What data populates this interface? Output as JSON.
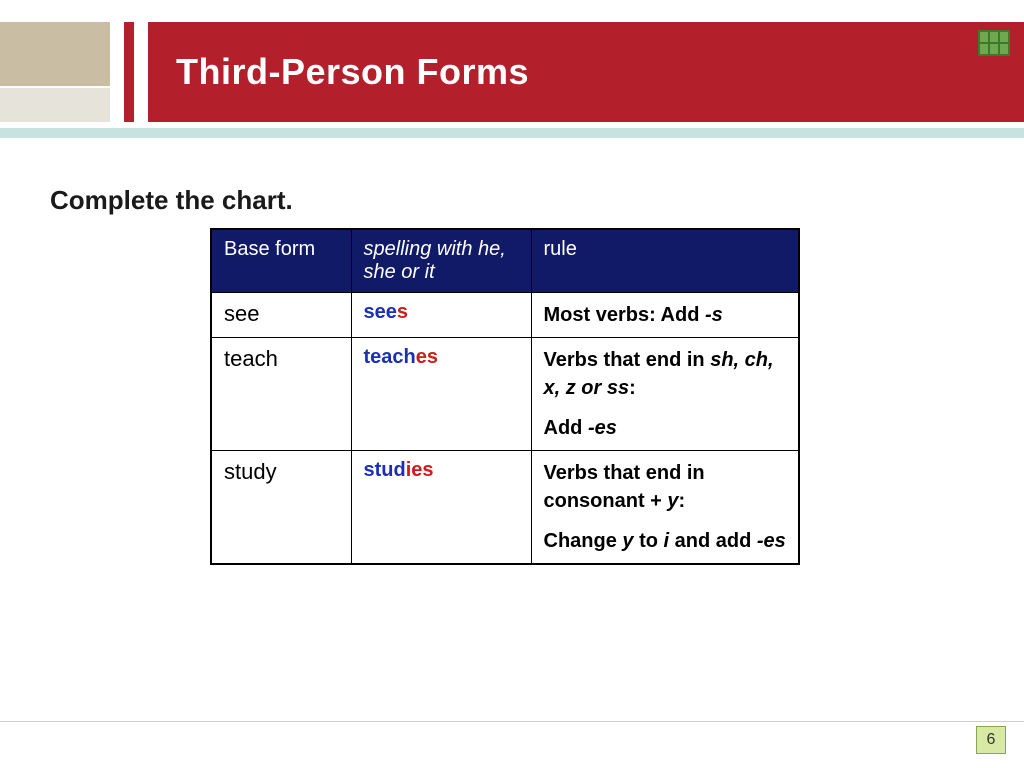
{
  "header": {
    "title": "Third-Person Forms"
  },
  "instruction": "Complete the chart.",
  "table": {
    "headers": {
      "col1": "Base form",
      "col2": "spelling with he, she or it",
      "col3": "rule"
    },
    "rows": [
      {
        "base": "see",
        "spelling_base": "see",
        "spelling_suffix": "s",
        "rule_pre": "Most verbs: Add ",
        "rule_em1": "-s",
        "rule_mid": "",
        "rule_em2": "",
        "rule_post": ""
      },
      {
        "base": "teach",
        "spelling_base": "teach",
        "spelling_suffix": "es",
        "rule_pre": "Verbs that end in ",
        "rule_em1": "sh, ch, x, z or ss",
        "rule_mid": ":",
        "rule_line2_pre": "Add ",
        "rule_line2_em": "-es"
      },
      {
        "base": "study",
        "spelling_base": "stud",
        "spelling_suffix": "ies",
        "rule_pre": "Verbs that end in consonant + ",
        "rule_em1": "y",
        "rule_mid": ":",
        "rule_line2_pre": "Change ",
        "rule_line2_em": "y",
        "rule_line2_mid": " to ",
        "rule_line2_em2": "i",
        "rule_line2_mid2": " and add ",
        "rule_line2_em3": "-es"
      }
    ]
  },
  "page_number": "6",
  "chart_data": {
    "type": "table",
    "title": "Third-Person Forms",
    "columns": [
      "Base form",
      "spelling with he, she or it",
      "rule"
    ],
    "rows": [
      [
        "see",
        "sees",
        "Most verbs: Add -s"
      ],
      [
        "teach",
        "teaches",
        "Verbs that end in sh, ch, x, z or ss: Add -es"
      ],
      [
        "study",
        "studies",
        "Verbs that end in consonant + y: Change y to i and add -es"
      ]
    ]
  }
}
